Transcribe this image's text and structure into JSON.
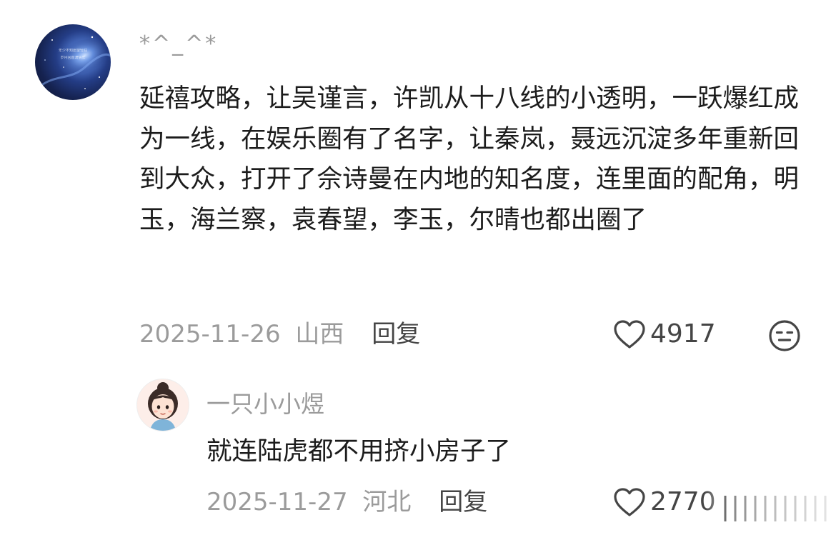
{
  "comment": {
    "username": "*^_^*",
    "avatar_caption_lines": [
      "年少不知愿望轻狂",
      "岁月回首渡情长"
    ],
    "text": "延禧攻略，让吴谨言，许凯从十八线的小透明，一跃爆红成为一线，在娱乐圈有了名字，让秦岚，聂远沉淀多年重新回到大众，打开了佘诗曼在内地的知名度，连里面的配角，明玉，海兰察，袁春望，李玉，尔晴也都出圈了",
    "date": "2025-11-26",
    "location": "山西",
    "reply_label": "回复",
    "likes": "4917",
    "like_icon": "heart-outline-icon",
    "more_icon": "smiley-neutral-icon"
  },
  "reply": {
    "username": "一只小小煜",
    "text": "就连陆虎都不用挤小房子了",
    "date": "2025-11-27",
    "location": "河北",
    "reply_label": "回复",
    "likes": "2770",
    "like_icon": "heart-outline-icon"
  },
  "colors": {
    "text_primary": "#1c1c1c",
    "text_secondary": "#9b9b9b",
    "text_action": "#454545",
    "background": "#ffffff"
  }
}
